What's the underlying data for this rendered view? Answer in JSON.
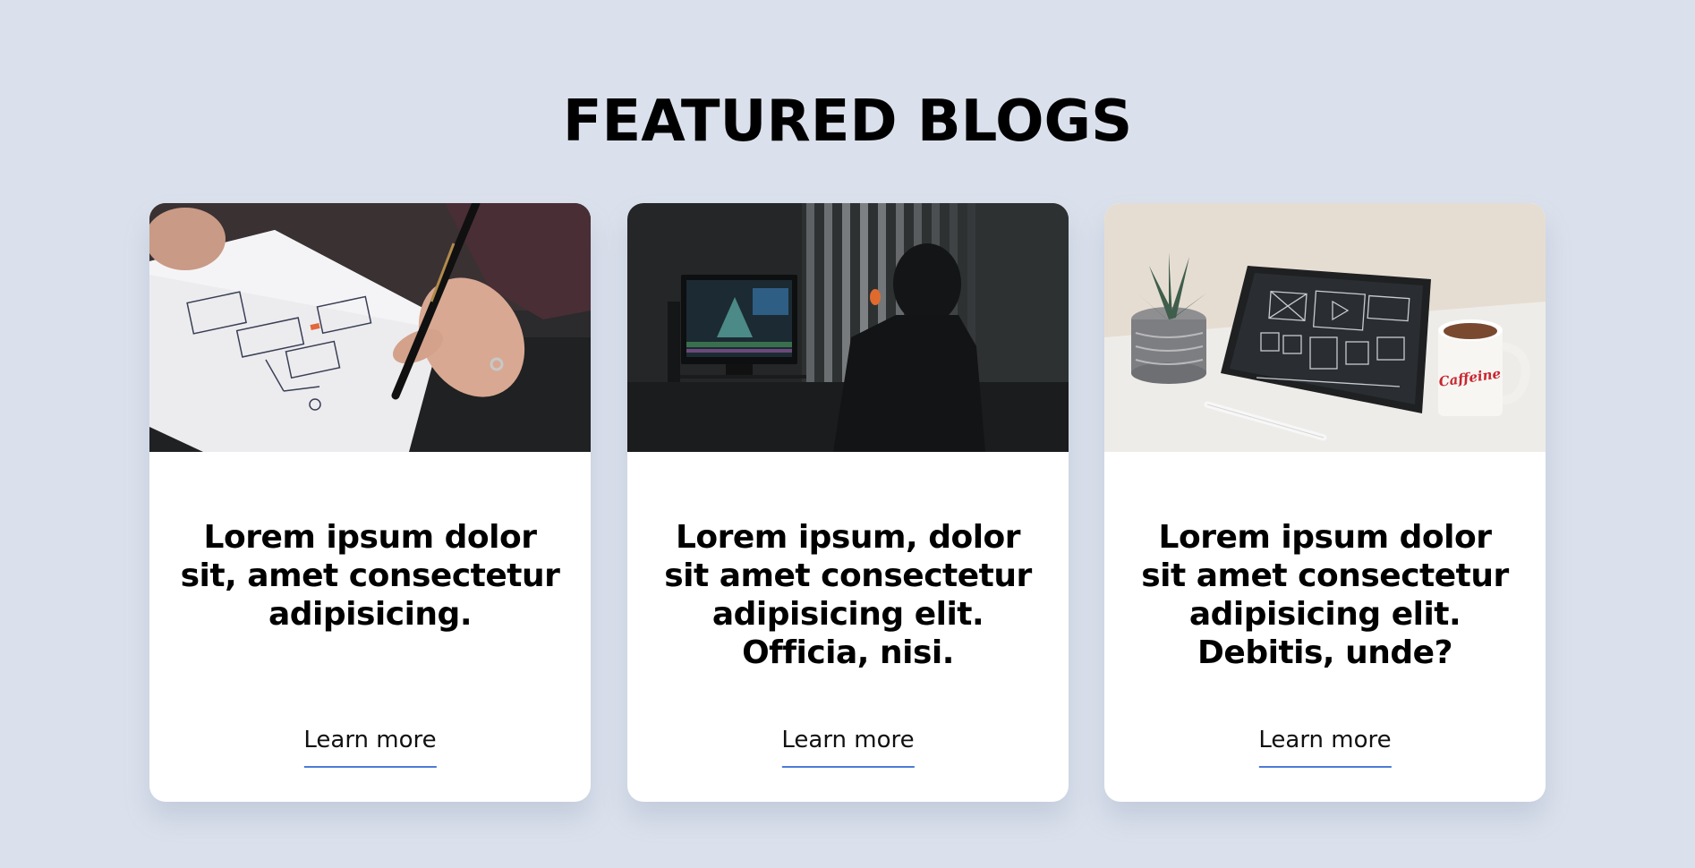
{
  "section": {
    "title": "FEATURED BLOGS"
  },
  "cards": [
    {
      "image": "hand-sketching-wireframe-photo",
      "title": "Lorem ipsum dolor sit, amet consectetur adipisicing.",
      "link_label": "Learn more"
    },
    {
      "image": "person-at-video-editing-monitor-photo",
      "title": "Lorem ipsum, dolor sit amet consectetur adipisicing elit. Officia, nisi.",
      "link_label": "Learn more"
    },
    {
      "image": "tablet-wireframe-with-coffee-mug-photo",
      "title": "Lorem ipsum dolor sit amet consectetur adipisicing elit. Debitis, unde?",
      "link_label": "Learn more",
      "mug_text": "Caffeine"
    }
  ],
  "colors": {
    "background": "#dbe1ec",
    "card": "#ffffff",
    "link_underline": "#4d7bd6"
  }
}
